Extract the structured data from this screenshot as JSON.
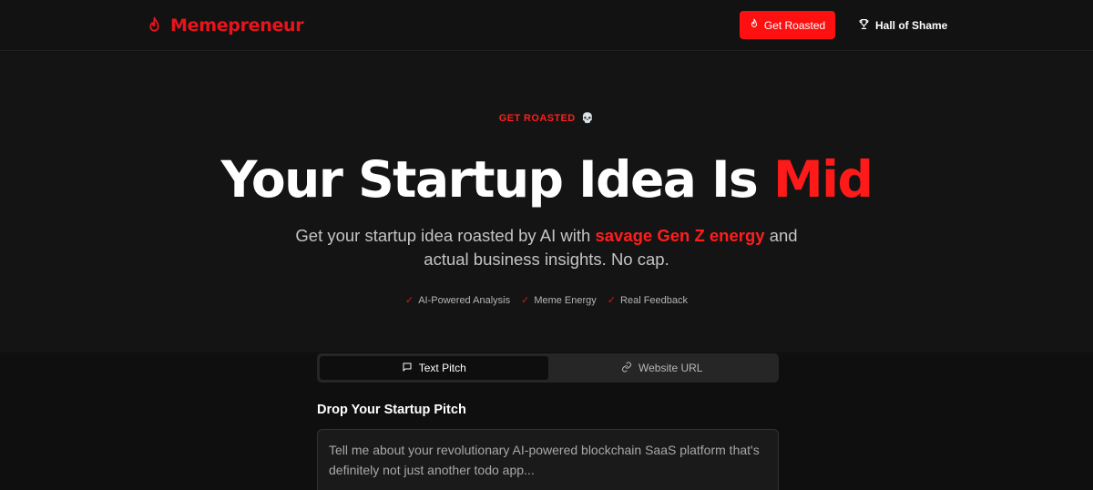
{
  "header": {
    "brand": "Memepreneur",
    "nav": {
      "get_roasted": "Get Roasted",
      "hall_of_shame": "Hall of Shame"
    }
  },
  "hero": {
    "eyebrow": "GET ROASTED",
    "eyebrow_emoji": "💀",
    "headline_main": "Your Startup Idea Is ",
    "headline_accent": "Mid",
    "subtitle_pre": "Get your startup idea roasted by AI with ",
    "subtitle_highlight": "savage Gen Z energy",
    "subtitle_post": " and actual business insights. No cap.",
    "features": [
      "AI-Powered Analysis",
      "Meme Energy",
      "Real Feedback"
    ],
    "check_glyph": "✓"
  },
  "form": {
    "tabs": [
      {
        "label": "Text Pitch",
        "icon": "message-square-icon",
        "active": true
      },
      {
        "label": "Website URL",
        "icon": "link-icon",
        "active": false
      }
    ],
    "pitch_label": "Drop Your Startup Pitch",
    "pitch_placeholder": "Tell me about your revolutionary AI-powered blockchain SaaS platform that's definitely not just another todo app..."
  },
  "colors": {
    "accent": "#ff1010",
    "background": "#0f0f0f",
    "hero_background": "#141414"
  }
}
